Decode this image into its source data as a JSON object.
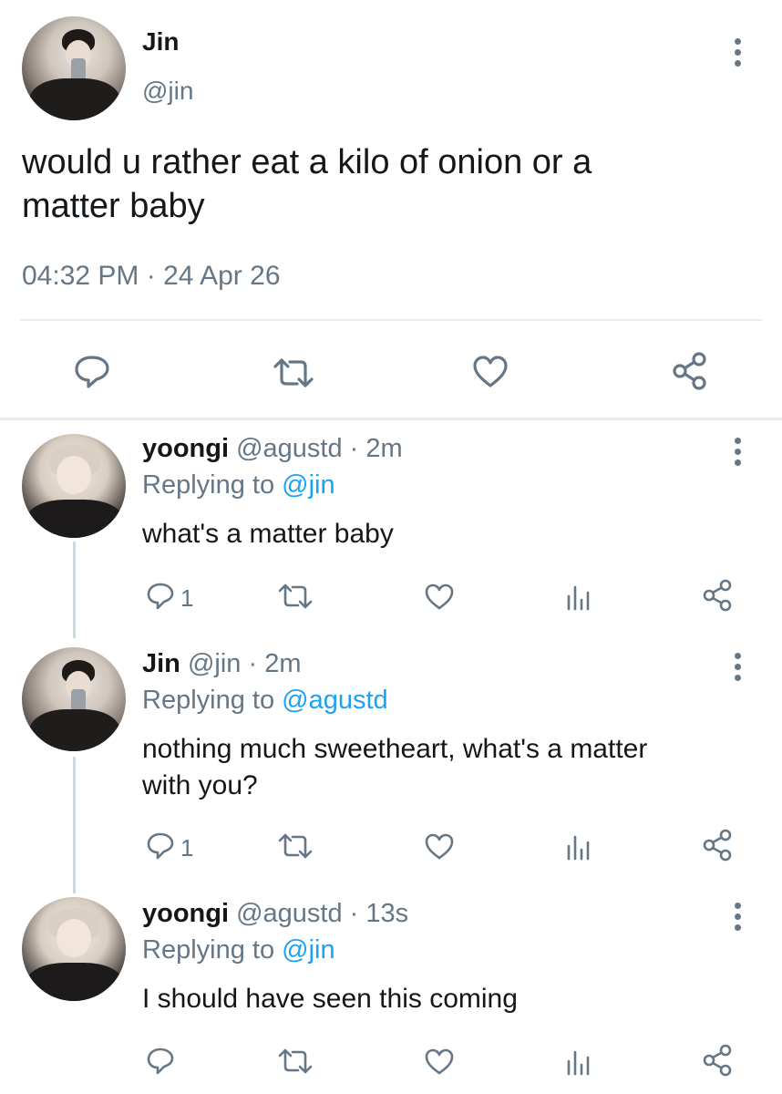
{
  "main_tweet": {
    "name": "Jin",
    "handle": "@jin",
    "text_line1": "would u rather eat a kilo of onion or a",
    "text_line2": "matter baby",
    "meta": "04:32 PM · 24 Apr 26",
    "actions": [
      "reply-icon",
      "retweet-icon",
      "like-icon",
      "share-icon"
    ]
  },
  "replies": [
    {
      "name": "yoongi",
      "handle_time": "@agustd · 2m",
      "replying_prefix": "Replying to",
      "replying_to": "@jin",
      "text_line1": "what's a matter baby",
      "text_line2": "",
      "reply_count": "1"
    },
    {
      "name": "Jin",
      "handle_time": "@jin · 2m",
      "replying_prefix": "Replying to",
      "replying_to": "@agustd",
      "text_line1": "nothing much sweetheart, what's a matter",
      "text_line2": "with you?",
      "reply_count": "1"
    },
    {
      "name": "yoongi",
      "handle_time": "@agustd · 13s",
      "replying_prefix": "Replying to",
      "replying_to": "@jin",
      "text_line1": "I should have seen this coming",
      "text_line2": "",
      "reply_count": ""
    }
  ],
  "colors": {
    "text": "#14171a",
    "secondary": "#657786",
    "link": "#1da1f2",
    "divider": "#e6ecf0"
  }
}
